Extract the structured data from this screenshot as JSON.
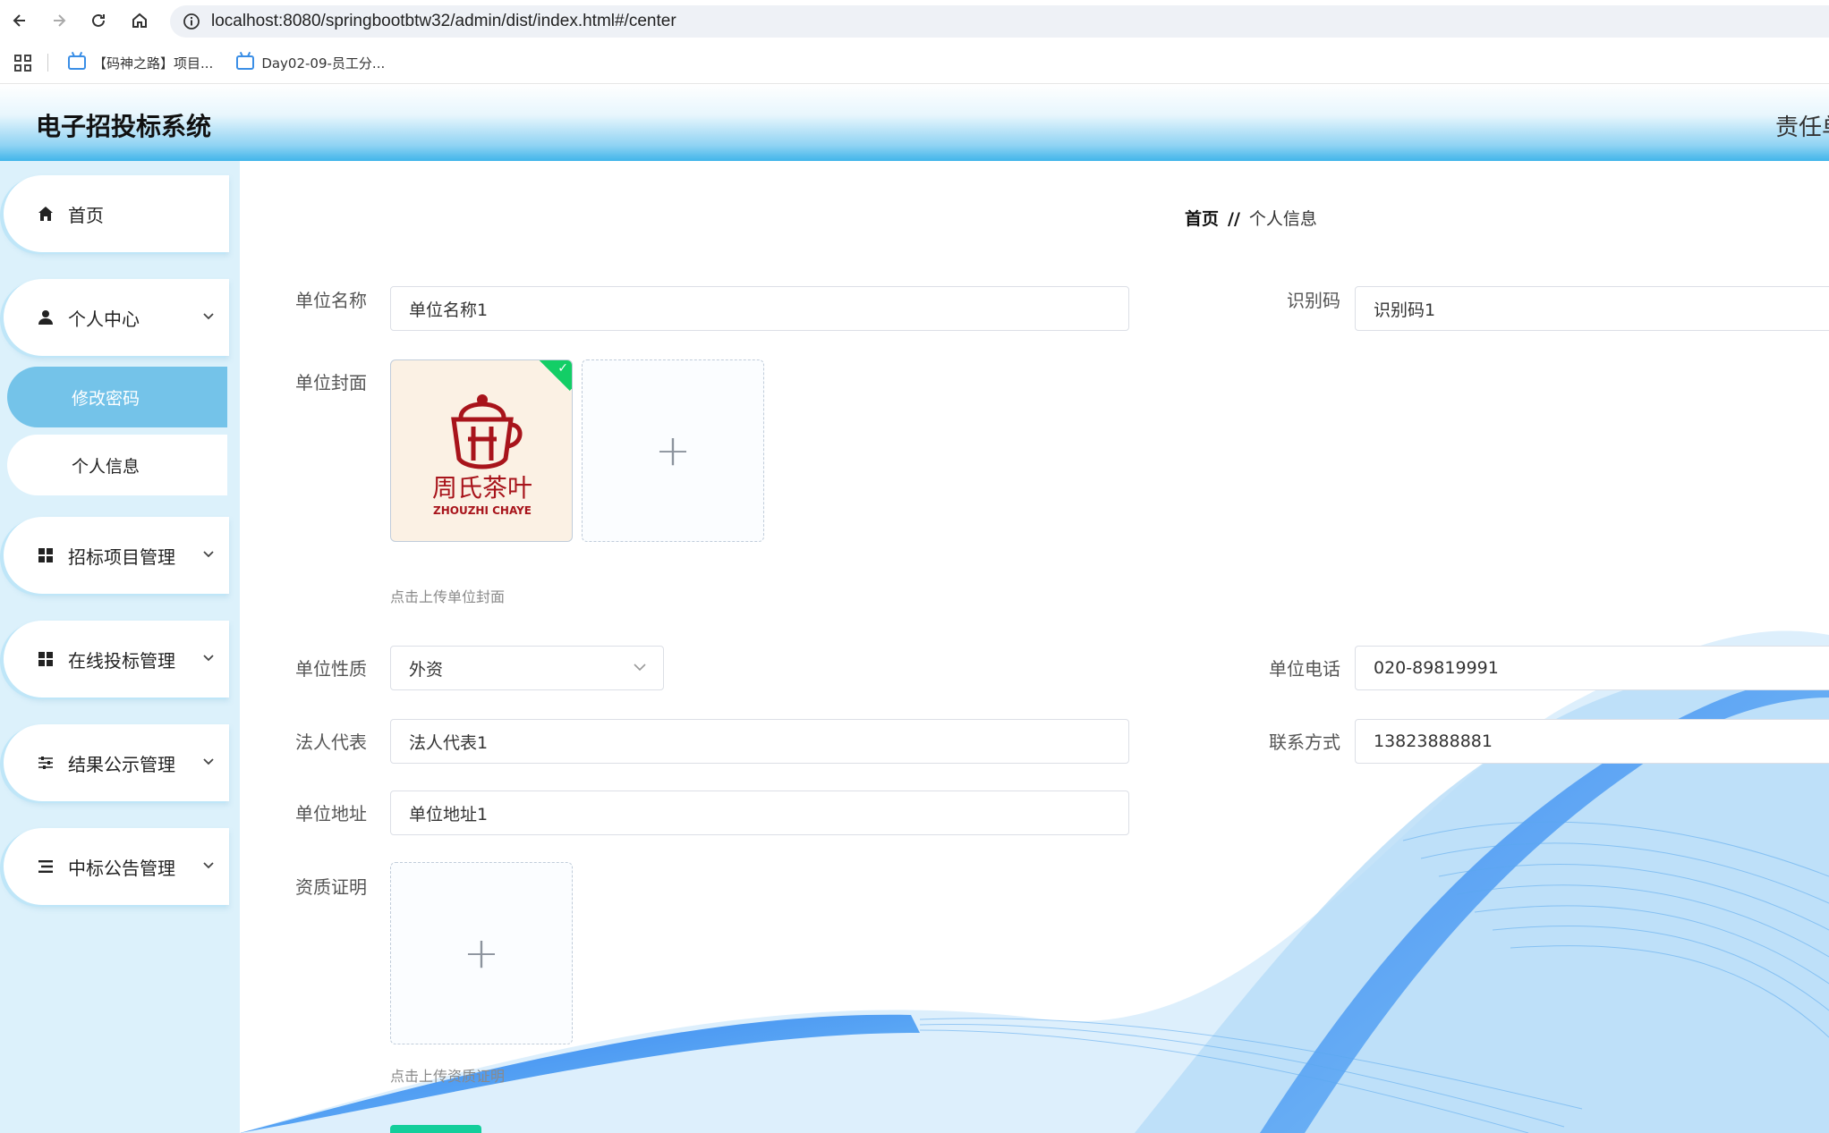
{
  "browser": {
    "url": "localhost:8080/springbootbtw32/admin/dist/index.html#/center",
    "bookmarks": [
      "【码神之路】项目...",
      "Day02-09-员工分..."
    ]
  },
  "header": {
    "title": "电子招投标系统",
    "user_text": "责任单"
  },
  "sidebar": {
    "items": [
      {
        "label": "首页",
        "icon": "home-icon"
      },
      {
        "label": "个人中心",
        "icon": "user-icon"
      },
      {
        "label": "招标项目管理",
        "icon": "grid-icon"
      },
      {
        "label": "在线投标管理",
        "icon": "grid-icon"
      },
      {
        "label": "结果公示管理",
        "icon": "sliders-icon"
      },
      {
        "label": "中标公告管理",
        "icon": "list-icon"
      }
    ],
    "subitems": [
      {
        "label": "修改密码",
        "active": true
      },
      {
        "label": "个人信息",
        "active": false
      }
    ]
  },
  "breadcrumb": {
    "home": "首页",
    "separator": "//",
    "current": "个人信息"
  },
  "form": {
    "unit_name": {
      "label": "单位名称",
      "value": "单位名称1"
    },
    "id_code": {
      "label": "识别码",
      "value": "识别码1"
    },
    "cover": {
      "label": "单位封面",
      "hint": "点击上传单位封面",
      "logo_cn": "周氏茶叶",
      "logo_en": "ZHOUZHI CHAYE"
    },
    "nature": {
      "label": "单位性质",
      "value": "外资"
    },
    "phone": {
      "label": "单位电话",
      "value": "020-89819991"
    },
    "legal_rep": {
      "label": "法人代表",
      "value": "法人代表1"
    },
    "contact": {
      "label": "联系方式",
      "value": "13823888881"
    },
    "address": {
      "label": "单位地址",
      "value": "单位地址1"
    },
    "qualification": {
      "label": "资质证明",
      "hint": "点击上传资质证明"
    }
  },
  "colors": {
    "accent": "#74c3e9",
    "sidebar_bg": "#dcf1fb",
    "success": "#13ce66"
  }
}
